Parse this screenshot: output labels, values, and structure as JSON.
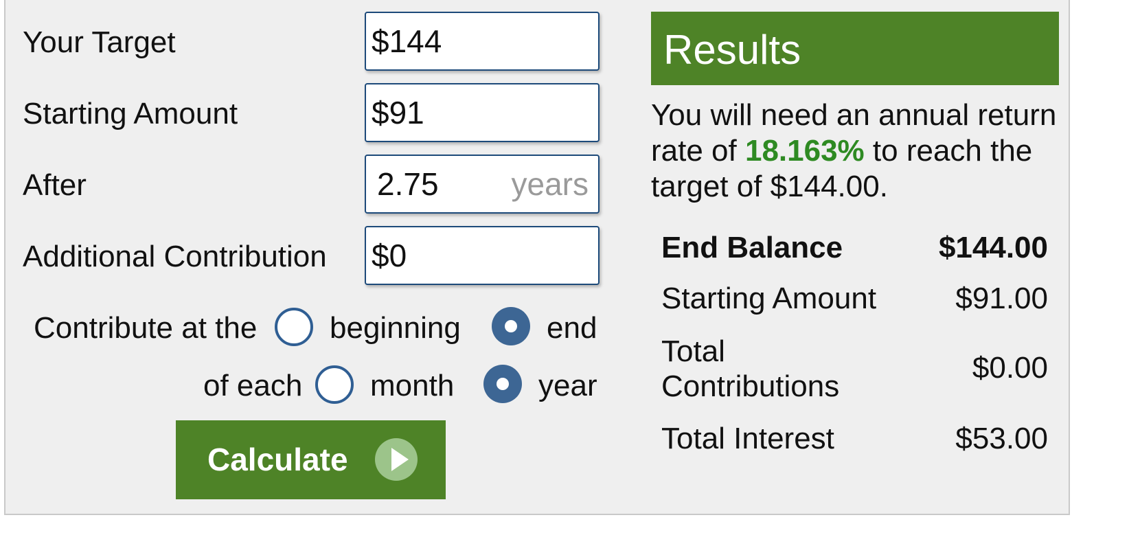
{
  "form": {
    "target_label": "Your Target",
    "target_value": "$144",
    "starting_label": "Starting Amount",
    "starting_value": "$91",
    "after_label": "After",
    "after_value": "2.75",
    "after_unit": "years",
    "contribution_label": "Additional Contribution",
    "contribution_value": "$0",
    "contribute_at_label": "Contribute at the",
    "timing_options": [
      "beginning",
      "end"
    ],
    "timing_selected": "end",
    "of_each_label": "of each",
    "period_options": [
      "month",
      "year"
    ],
    "period_selected": "year",
    "calculate_label": "Calculate"
  },
  "results": {
    "title": "Results",
    "summary_before": "You will need an annual return rate of ",
    "rate": "18.163%",
    "summary_after": " to reach the target of $144.00.",
    "rows": [
      {
        "label": "End Balance",
        "value": "$144.00"
      },
      {
        "label": "Starting Amount",
        "value": "$91.00"
      },
      {
        "label_line1": "Total",
        "label_line2": "Contributions",
        "value": "$0.00"
      },
      {
        "label": "Total Interest",
        "value": "$53.00"
      }
    ]
  },
  "colors": {
    "accent_green": "#4e8327",
    "rate_green": "#2e8a22",
    "input_border": "#1d4a7a",
    "radio_blue": "#3d6694"
  },
  "icons": {
    "calculate_button_icon": "play-icon"
  }
}
